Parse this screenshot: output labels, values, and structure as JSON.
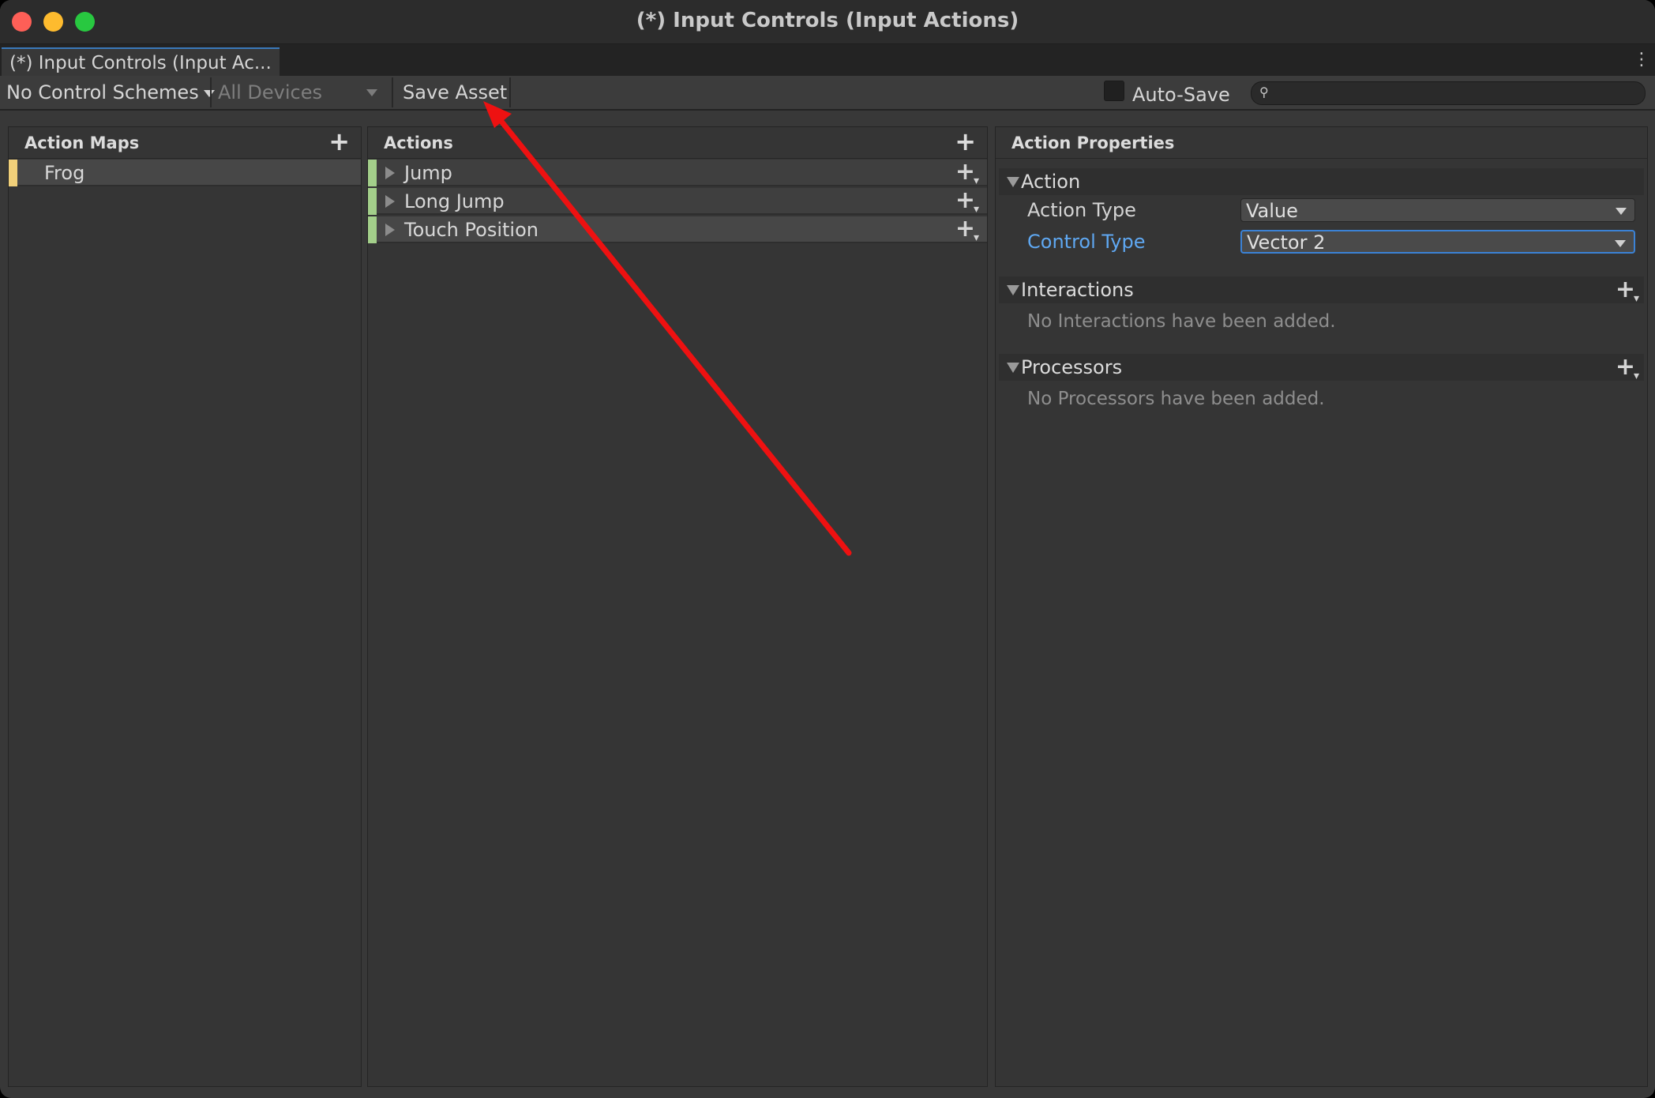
{
  "window": {
    "title": "(*) Input Controls (Input Actions)",
    "tab_label": "(*) Input Controls (Input Ac...",
    "menu_glyph": "⋮"
  },
  "toolbar": {
    "control_scheme": "No Control Schemes",
    "devices": "All Devices",
    "save_label": "Save Asset",
    "auto_save_label": "Auto-Save",
    "auto_save_checked": false,
    "search_icon": "⚲",
    "search_value": ""
  },
  "action_maps": {
    "header": "Action Maps",
    "add_glyph": "+",
    "items": [
      {
        "label": "Frog",
        "selected": true,
        "marker_color": "#f1d07a"
      }
    ]
  },
  "actions": {
    "header": "Actions",
    "add_glyph": "+",
    "add_binding_glyph": "+",
    "items": [
      {
        "label": "Jump",
        "marker_color": "#a3cf8a",
        "selected": false
      },
      {
        "label": "Long Jump",
        "marker_color": "#a3cf8a",
        "selected": false
      },
      {
        "label": "Touch Position",
        "marker_color": "#a3cf8a",
        "selected": true
      }
    ]
  },
  "properties": {
    "header": "Action Properties",
    "action_section": "Action",
    "action_type_label": "Action Type",
    "action_type_value": "Value",
    "control_type_label": "Control Type",
    "control_type_value": "Vector 2",
    "interactions_section": "Interactions",
    "interactions_empty": "No Interactions have been added.",
    "processors_section": "Processors",
    "processors_empty": "No Processors have been added.",
    "add_glyph": "+"
  },
  "annotation": {
    "arrow_color": "#ee1111"
  }
}
